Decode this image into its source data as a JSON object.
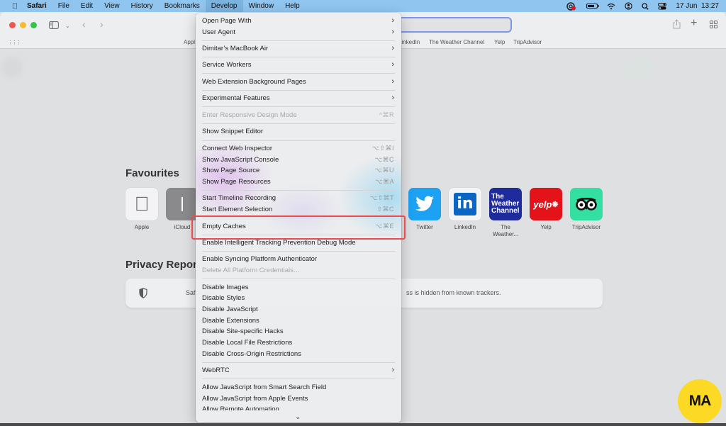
{
  "menubar": {
    "apple_icon": "apple-logo-icon",
    "items": [
      "Safari",
      "File",
      "Edit",
      "View",
      "History",
      "Bookmarks",
      "Develop",
      "Window",
      "Help"
    ],
    "active_item": "Develop",
    "status_icons": [
      "creative-cloud-icon",
      "battery-icon",
      "wifi-icon",
      "user-icon",
      "search-icon",
      "control-center-icon"
    ],
    "clock": "17 Jun  13:27"
  },
  "toolbar": {
    "sidebar_icon": "sidebar-icon",
    "back_icon": "chevron-left-icon",
    "forward_icon": "chevron-right-icon",
    "share_icon": "share-icon",
    "new_tab_icon": "plus-icon",
    "tab_overview_icon": "grid-icon",
    "address_value": ""
  },
  "favourites_bar": {
    "items_left": [
      "Appl"
    ],
    "items_right": [
      "LinkedIn",
      "The Weather Channel",
      "Yelp",
      "TripAdvisor"
    ]
  },
  "start_page": {
    "favourites_title": "Favourites",
    "favourites": [
      {
        "label": "Apple",
        "color": "#f3f3f5"
      },
      {
        "label": "iCloud",
        "color": "#8a8a8c"
      },
      {
        "label": "Twitter",
        "color": "#1da1f2"
      },
      {
        "label": "LinkedIn",
        "color": "#f4f4f6"
      },
      {
        "label": "The Weather...",
        "color": "#1f2a9b",
        "tile_text": "The Weather Channel"
      },
      {
        "label": "Yelp",
        "color": "#e4131a",
        "tile_text": "yelp"
      },
      {
        "label": "TripAdvisor",
        "color": "#34e0a1"
      }
    ],
    "privacy_title": "Privacy Repor",
    "privacy_text_left": "Safari has",
    "privacy_text_right": "ss is hidden from known trackers."
  },
  "develop_menu": {
    "items": [
      {
        "label": "Open Page With",
        "submenu": true
      },
      {
        "label": "User Agent",
        "submenu": true
      },
      {
        "label": "Dimitar’s MacBook Air",
        "submenu": true
      },
      {
        "label": "Service Workers",
        "submenu": true
      },
      {
        "label": "Web Extension Background Pages",
        "submenu": true
      },
      {
        "label": "Experimental Features",
        "submenu": true
      },
      {
        "label": "Enter Responsive Design Mode",
        "shortcut": "^⌘R",
        "disabled": true
      },
      {
        "label": "Show Snippet Editor"
      },
      {
        "label": "Connect Web Inspector",
        "shortcut": "⌥⇧⌘I"
      },
      {
        "label": "Show JavaScript Console",
        "shortcut": "⌥⌘C"
      },
      {
        "label": "Show Page Source",
        "shortcut": "⌥⌘U"
      },
      {
        "label": "Show Page Resources",
        "shortcut": "⌥⌘A"
      },
      {
        "label": "Start Timeline Recording",
        "shortcut": "⌥⇧⌘T"
      },
      {
        "label": "Start Element Selection",
        "shortcut": "⇧⌘C"
      },
      {
        "label": "Empty Caches",
        "shortcut": "⌥⌘E",
        "highlighted": true
      },
      {
        "label": "Enable Intelligent Tracking Prevention Debug Mode"
      },
      {
        "label": "Enable Syncing Platform Authenticator"
      },
      {
        "label": "Delete All Platform Credentials…",
        "disabled": true
      },
      {
        "label": "Disable Images"
      },
      {
        "label": "Disable Styles"
      },
      {
        "label": "Disable JavaScript"
      },
      {
        "label": "Disable Extensions"
      },
      {
        "label": "Disable Site-specific Hacks"
      },
      {
        "label": "Disable Local File Restrictions"
      },
      {
        "label": "Disable Cross-Origin Restrictions"
      },
      {
        "label": "WebRTC",
        "submenu": true
      },
      {
        "label": "Allow JavaScript from Smart Search Field"
      },
      {
        "label": "Allow JavaScript from Apple Events"
      },
      {
        "label": "Allow Remote Automation"
      }
    ],
    "scroll_indicator": "chevron-down-icon"
  },
  "watermark": {
    "text": "MA",
    "color": "#fbd925"
  },
  "colors": {
    "menubar": "#8fc5ee",
    "highlight_border": "#e94b50",
    "address_focus": "#7d95ef"
  }
}
